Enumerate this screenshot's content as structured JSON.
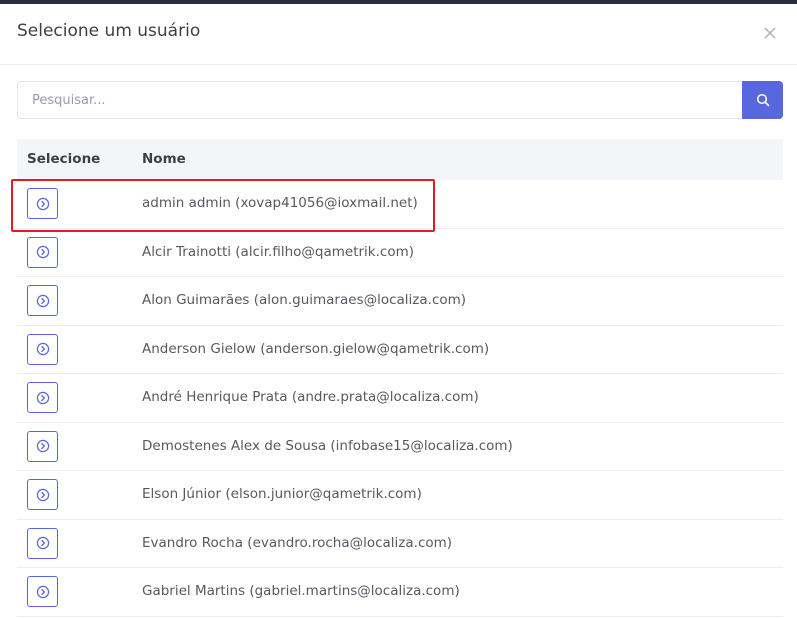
{
  "modal": {
    "title": "Selecione um usuário",
    "close_icon": "close-icon"
  },
  "search": {
    "placeholder": "Pesquisar...",
    "value": "",
    "button_icon": "search-icon"
  },
  "table": {
    "headers": {
      "select": "Selecione",
      "name": "Nome"
    },
    "rows": [
      "admin admin (xovap41056@ioxmail.net)",
      "Alcir Trainotti (alcir.filho@qametrik.com)",
      "Alon Guimarães (alon.guimaraes@localiza.com)",
      "Anderson Gielow (anderson.gielow@qametrik.com)",
      "André Henrique Prata (andre.prata@localiza.com)",
      "Demostenes Alex de Sousa (infobase15@localiza.com)",
      "Elson Júnior (elson.junior@qametrik.com)",
      "Evandro Rocha (evandro.rocha@localiza.com)",
      "Gabriel Martins (gabriel.martins@localiza.com)"
    ]
  },
  "colors": {
    "accent": "#5867dd",
    "highlight": "#e11d1d",
    "header_bg": "#f4f5f8"
  }
}
